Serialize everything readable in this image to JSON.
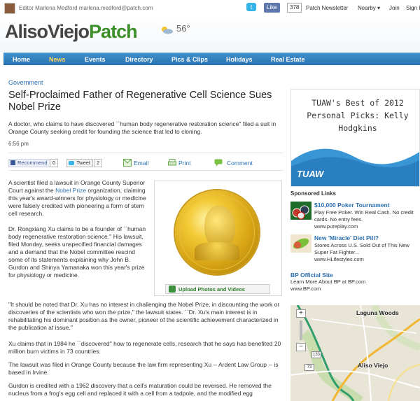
{
  "topbar": {
    "editor": "Editor Marlena Medford marlena.medford@patch.com",
    "like_label": "Like",
    "like_count": "378",
    "newsletter": "Patch Newsletter",
    "nearby": "Nearby ▾",
    "join": "Join",
    "signin": "Sign I"
  },
  "header": {
    "logo_city": "AlisoViejo",
    "logo_patch": "Patch",
    "temperature": "56°"
  },
  "nav": {
    "items": [
      "Home",
      "News",
      "Events",
      "Directory",
      "Pics & Clips",
      "Holidays",
      "Real Estate"
    ],
    "active": "News"
  },
  "article": {
    "category": "Government",
    "headline": "Self-Proclaimed Father of Regenerative Cell Science Sues Nobel Prize",
    "dek": "A doctor, who claims to have discovered ``human body regenerative restoration science'' filed a suit in Orange County seeking credit for founding the science that led to cloning.",
    "timestamp": "6:56 pm",
    "share": {
      "recommend": "Recommend",
      "recommend_count": "0",
      "tweet": "Tweet",
      "tweet_count": "2",
      "email": "Email",
      "print": "Print",
      "comment": "Comment"
    },
    "p1_before_link": "A scientist filed a lawsuit in Orange County Superior Court against the ",
    "p1_link": "Nobel Prize",
    "p1_after_link": " organization, claiming this year's award-winners for physiology or medicine were falsely credited with pioneering a form of stem cell research.",
    "p2": "Dr. Rongxiang Xu claims to be a founder of ``human body regenerative restoration science.'' His lawsuit, filed Monday, seeks unspecified financial damages and a demand that the Nobel committee rescind some of its statements explaining why John B. Gurdon and Shinya Yamanaka won this year's prize for physiology or medicine.",
    "p3": "\"It should be noted that Dr. Xu has no interest in challenging the Nobel Prize, in discounting the work or discoveries of the scientists who won the prize,\" the lawsuit states. ``Dr. Xu's main interest is in rehabilitating his dominant position as the owner, pioneer of the scientific achievement characterized in the publication at issue.\"",
    "p4": "Xu claims that in 1984 he ``discovered'' how to regenerate cells, research that he says has benefited 20 million burn victims in 73 countries.",
    "p5": "The lawsuit was filed in Orange County because the law firm representing Xu -- Ardent Law Group -- is based in Irvine.",
    "p6": "Gurdon is credited with a 1962 discovery that a cell's maturation could be reversed. He removed the nucleus from a frog's egg cell and replaced it with a cell from a tadpole, and the modified egg",
    "upload_label": "Upload Photos and Videos"
  },
  "rail": {
    "ad_title": "TUAW's Best of 2012 Personal Picks: Kelly Hodgkins",
    "ad_brand": "TUAW",
    "sponsored_label": "Sponsored Links",
    "sponsors": [
      {
        "title": "$10,000 Poker Tournament",
        "desc": "Play Free Poker. Win Real Cash. No credit cards. No entry fees.",
        "url": "www.pureplay.com"
      },
      {
        "title": "New 'Miracle' Diet Pill?",
        "desc": "Stores Across U.S. Sold Out of This New Super Fat Fighter...",
        "url": "www.HLifestyles.com"
      }
    ],
    "bp_title": "BP Official Site",
    "bp_desc": "Learn More About BP at BP.com",
    "bp_url": "www.BP.com",
    "map": {
      "place1": "Laguna Woods",
      "place2": "Aliso Viejo",
      "shield1": "133",
      "shield2": "73",
      "zoom_in": "+",
      "zoom_out": "−"
    }
  },
  "colors": {
    "nav_blue": "#2a73b2",
    "link_blue": "#2a6fb0",
    "patch_green": "#3d8f2a",
    "active_nav": "#ffd35a"
  }
}
